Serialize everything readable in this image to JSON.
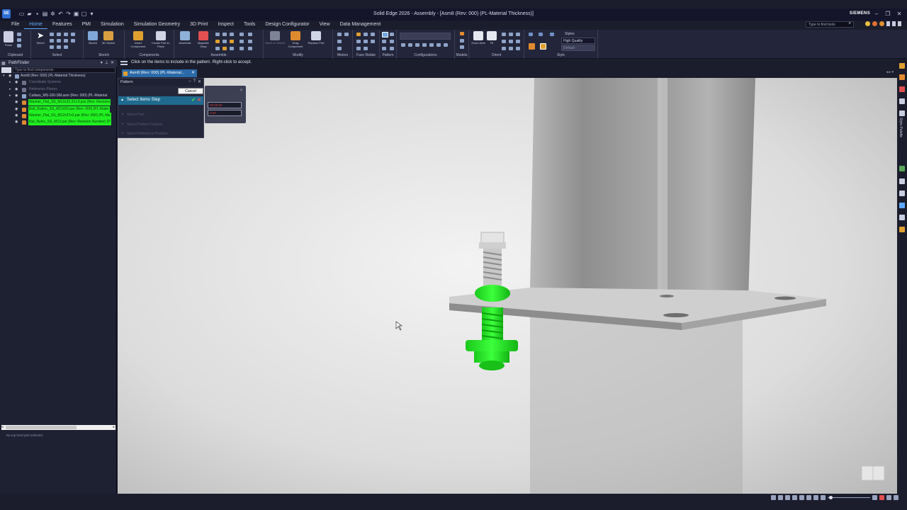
{
  "titlebar": {
    "app_logo": "SE",
    "title": "Solid Edge 2026 - Assembly - [Asm8 (Rev: 000)  (PL-Material Thickness)]",
    "brand": "SIEMENS",
    "qat_icons": [
      "new-icon",
      "open-icon",
      "save-icon",
      "print-icon",
      "settings-icon",
      "undo-icon",
      "redo-icon"
    ],
    "controls": [
      "minimize",
      "restore",
      "close"
    ]
  },
  "menu": {
    "items": [
      "File",
      "Home",
      "Features",
      "PMI",
      "Simulation",
      "Simulation Geometry",
      "3D Print",
      "Inspect",
      "Tools",
      "Design Configurator",
      "View",
      "Data Management"
    ],
    "active": "Home",
    "search_placeholder": "Type to find tools"
  },
  "ribbon": {
    "groups": [
      "Clipboard",
      "Select",
      "Sketch",
      "Components",
      "Assemble",
      "Modify",
      "Motors",
      "Face Relate",
      "Pattern",
      "Configurations",
      "Models",
      "Orient",
      "Style"
    ],
    "buttons": {
      "paste": "Paste",
      "select": "Select",
      "sketch": "Sketch",
      "sketch3d": "3D Sketch",
      "insert_component": "Insert Component",
      "create_part": "Create Part In-Place",
      "assemble": "Assemble",
      "magnetic_snap": "Magnetic Snap",
      "move_on_select": "Move on Select",
      "drag_component": "Drag Component",
      "replace_part": "Replace Part",
      "zoom_area": "Zoom Area",
      "fit": "Fit"
    },
    "styles_label": "Styles",
    "style_quality": "High Quality",
    "style_secondary": "Default"
  },
  "prompt": "Click on the items to include in the pattern.  Right-click to accept.",
  "pathfinder": {
    "title": "PathFinder",
    "filter_placeholder": "Type to find components",
    "rows": [
      {
        "label": "Asm8 (Rev: 000)  (PL-Material Thickness)",
        "kind": "normal",
        "indent": 0
      },
      {
        "label": "Coordinate Systems",
        "kind": "dim",
        "indent": 1
      },
      {
        "label": "Reference Planes",
        "kind": "dim",
        "indent": 1
      },
      {
        "label": "Cutlass_MS-100-SM.asm (Rev: 000)  (PL-Material",
        "kind": "normal",
        "indent": 1
      },
      {
        "label": "Washer_Flat_SS_M12x22.2x1.6.par (Rev: Revision",
        "kind": "hl",
        "indent": 1
      },
      {
        "label": "Bolt_Button_SS_M12x50.par (Rev: 000)  (PL-Mater",
        "kind": "hl",
        "indent": 1
      },
      {
        "label": "Washer_Flat_SS_M12x37x3.par (Rev: 000)  (PL-Ma",
        "kind": "hl",
        "indent": 1
      },
      {
        "label": "Nut_Nyloc_SS_M12.par (Rev: Revision Number)  (P",
        "kind": "hl",
        "indent": 1
      }
    ],
    "status": "No top level part selected."
  },
  "document_tab": {
    "label": "Asm8 (Rev: 000)  (PL-Material..."
  },
  "pattern": {
    "title": "Pattern",
    "cancel_label": "Cancel",
    "steps": [
      "Select Items Step",
      "Select Part",
      "Select Pattern Feature",
      "Select Reference Position"
    ],
    "active_step": "Select Items Step",
    "sub_fields": [
      "00:00:00",
      "0.00"
    ]
  },
  "side_rail": {
    "label": "Style Palette"
  },
  "colors": {
    "accent": "#5fa8ff",
    "highlight_green": "#20f020",
    "step_active": "#1f6b8f",
    "background": "#1b1d2c"
  }
}
